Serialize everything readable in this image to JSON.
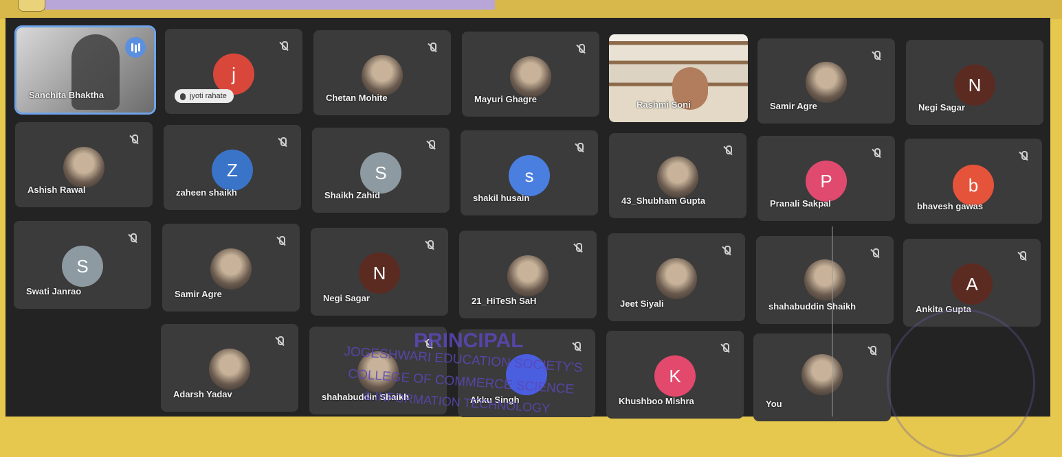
{
  "participants": [
    {
      "id": "t1",
      "name": "Sanchita Bhaktha"
    },
    {
      "id": "t2",
      "name": "jyoti rahate",
      "avatar_letter": "j",
      "avatar_color": "#d9473b"
    },
    {
      "id": "t3",
      "name": "Chetan Mohite"
    },
    {
      "id": "t4",
      "name": "Mayuri Ghagre"
    },
    {
      "id": "t5",
      "name": "Rashmi Soni"
    },
    {
      "id": "t6",
      "name": "Samir Agre"
    },
    {
      "id": "t7",
      "name": "Negi Sagar",
      "avatar_letter": "N",
      "avatar_color": "#5b2b22"
    },
    {
      "id": "t8",
      "name": "Ashish Rawal"
    },
    {
      "id": "t9",
      "name": "zaheen shaikh",
      "avatar_letter": "Z",
      "avatar_color": "#3a74c9"
    },
    {
      "id": "t10",
      "name": "Shaikh Zahid",
      "avatar_letter": "S",
      "avatar_color": "#8e9aa1"
    },
    {
      "id": "t11",
      "name": "shakil husain",
      "avatar_letter": "s",
      "avatar_color": "#4a7fe0"
    },
    {
      "id": "t12",
      "name": "43_Shubham Gupta"
    },
    {
      "id": "t13",
      "name": "Pranali Sakpal",
      "avatar_letter": "P",
      "avatar_color": "#e04a6f"
    },
    {
      "id": "t14",
      "name": "bhavesh gawas",
      "avatar_letter": "b",
      "avatar_color": "#e5533b"
    },
    {
      "id": "t15",
      "name": "Swati Janrao",
      "avatar_letter": "S",
      "avatar_color": "#8e9aa1"
    },
    {
      "id": "t16",
      "name": "Samir Agre"
    },
    {
      "id": "t17",
      "name": "Negi Sagar",
      "avatar_letter": "N",
      "avatar_color": "#5b2b22"
    },
    {
      "id": "t18",
      "name": "21_HiTeSh SaH"
    },
    {
      "id": "t19",
      "name": "Jeet Siyali"
    },
    {
      "id": "t20",
      "name": "shahabuddin Shaikh"
    },
    {
      "id": "t21",
      "name": "Ankita Gupta",
      "avatar_letter": "A",
      "avatar_color": "#5b2b22"
    },
    {
      "id": "t22",
      "name": "Adarsh Yadav"
    },
    {
      "id": "t23",
      "name": "shahabuddin Shaikh"
    },
    {
      "id": "t24",
      "name": "Akku Singh",
      "avatar_color": "#4a5fe0"
    },
    {
      "id": "t25",
      "name": "Khushboo Mishra",
      "avatar_letter": "K",
      "avatar_color": "#e2496c"
    },
    {
      "id": "t26",
      "name": "You"
    }
  ],
  "stamp": {
    "title": "PRINCIPAL",
    "line1": "JOGESHWARI EDUCATION SOCIETY'S",
    "line2": "COLLEGE OF COMMERCE SCIENCE",
    "line3": "& INFORMATION TECHNOLOGY"
  },
  "colors": {
    "speaking_ring": "#6fa3e8",
    "tile_bg": "#3b3b3b",
    "screen_bg": "#232323"
  }
}
